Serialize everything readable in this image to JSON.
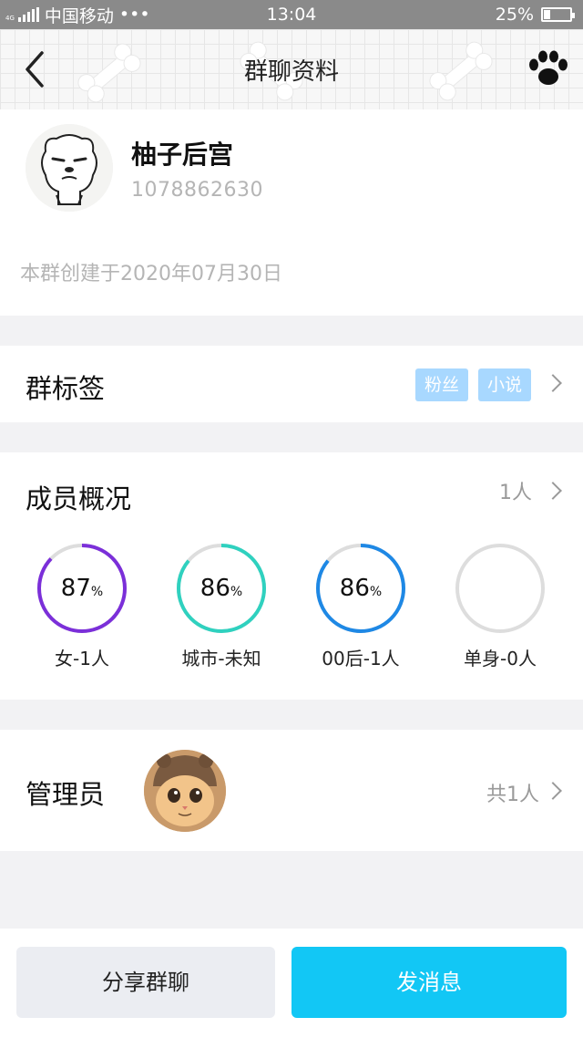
{
  "status_bar": {
    "network": "4G",
    "carrier": "中国移动",
    "dots": "•••",
    "time": "13:04",
    "battery": "25%"
  },
  "nav": {
    "title": "群聊资料"
  },
  "group": {
    "name": "柚子后宫",
    "id": "1078862630",
    "created": "本群创建于2020年07月30日"
  },
  "tags": {
    "title": "群标签",
    "items": [
      "粉丝",
      "小说"
    ]
  },
  "members": {
    "title": "成员概况",
    "count": "1人",
    "stats": [
      {
        "value": "87",
        "unit": "%",
        "label": "女-1人",
        "fraction": 0.87,
        "color": "#7b2fd9"
      },
      {
        "value": "86",
        "unit": "%",
        "label": "城市-未知",
        "fraction": 0.86,
        "color": "#2fd1bf"
      },
      {
        "value": "86",
        "unit": "%",
        "label": "00后-1人",
        "fraction": 0.86,
        "color": "#1e88e5"
      },
      {
        "value": "",
        "unit": "",
        "label": "单身-0人",
        "fraction": 0,
        "color": "#dddddd"
      }
    ]
  },
  "admin": {
    "title": "管理员",
    "count": "共1人"
  },
  "actions": {
    "share": "分享群聊",
    "send": "发消息"
  },
  "colors": {
    "accent": "#12c7f5",
    "tag_bg": "#a8d8ff"
  }
}
